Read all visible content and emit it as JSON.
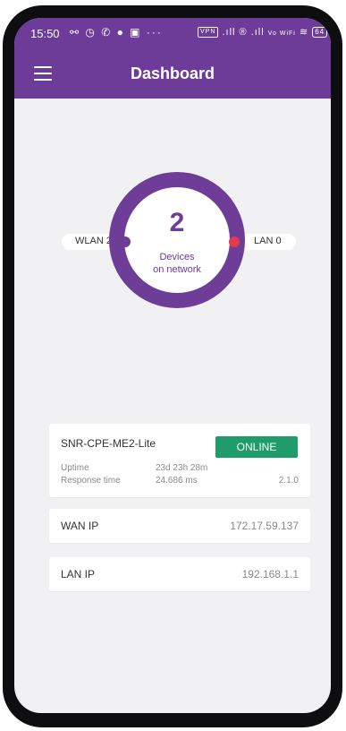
{
  "status_bar": {
    "time": "15:50",
    "left_icons": "⚯ ◷ ✆ ● ▣ ···",
    "vpn": "VPN",
    "signal": ".ıll ® .ıll",
    "wifi_label": "Vo WiFi",
    "battery": "64"
  },
  "app_bar": {
    "title": "Dashboard",
    "menu_icon": "hamburger-menu-icon"
  },
  "network": {
    "device_count": "2",
    "devices_label_line1": "Devices",
    "devices_label_line2": "on network",
    "wlan_label": "WLAN 2",
    "lan_label": "LAN 0",
    "colors": {
      "ring": "#6e3d98",
      "wlan_dot": "#6e3d98",
      "lan_dot": "#e43c4a"
    }
  },
  "device": {
    "name": "SNR-CPE-ME2-Lite",
    "status": "ONLINE",
    "status_color": "#1f9c6c",
    "uptime_label": "Uptime",
    "uptime_value": "23d 23h 28m",
    "response_label": "Response time",
    "response_value": "24.686 ms",
    "version": "2.1.0"
  },
  "wan": {
    "label": "WAN IP",
    "value": "172.17.59.137"
  },
  "lan": {
    "label": "LAN IP",
    "value": "192.168.1.1"
  },
  "theme": {
    "primary": "#6c3c98",
    "background": "#f1f1f3"
  }
}
